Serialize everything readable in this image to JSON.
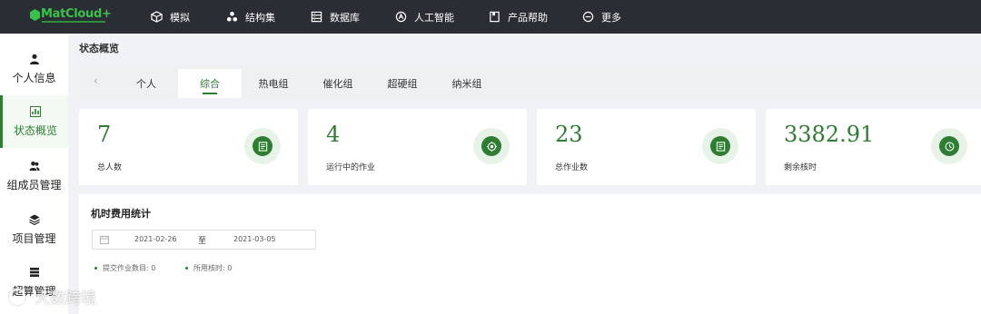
{
  "header": {
    "logo_text": "MatCloud+",
    "nav": [
      {
        "label": "模拟",
        "icon": "cube-icon"
      },
      {
        "label": "结构集",
        "icon": "molecule-icon"
      },
      {
        "label": "数据库",
        "icon": "database-icon"
      },
      {
        "label": "人工智能",
        "icon": "ai-icon"
      },
      {
        "label": "产品帮助",
        "icon": "help-book-icon"
      },
      {
        "label": "更多",
        "icon": "more-circle-icon"
      }
    ]
  },
  "sidebar": {
    "items": [
      {
        "label": "个人信息",
        "icon": "user-icon"
      },
      {
        "label": "状态概览",
        "icon": "chart-icon",
        "active": true
      },
      {
        "label": "组成员管理",
        "icon": "group-icon"
      },
      {
        "label": "项目管理",
        "icon": "layers-icon"
      },
      {
        "label": "超算管理",
        "icon": "server-icon"
      }
    ]
  },
  "main": {
    "page_title": "状态概览",
    "tabs": [
      {
        "label": "个人"
      },
      {
        "label": "综合",
        "active": true
      },
      {
        "label": "热电组"
      },
      {
        "label": "催化组"
      },
      {
        "label": "超硬组"
      },
      {
        "label": "纳米组"
      }
    ],
    "cards": [
      {
        "value": "7",
        "label": "总人数",
        "icon": "document-icon"
      },
      {
        "value": "4",
        "label": "运行中的作业",
        "icon": "target-icon"
      },
      {
        "value": "23",
        "label": "总作业数",
        "icon": "document-icon"
      },
      {
        "value": "3382.91",
        "label": "剩余核时",
        "icon": "clock-icon"
      }
    ],
    "stats": {
      "title": "机时费用统计",
      "date_start": "2021-02-26",
      "date_separator": "至",
      "date_end": "2021-03-05",
      "legend": [
        {
          "label": "提交作业数目: 0"
        },
        {
          "label": "所用核时: 0"
        }
      ]
    }
  },
  "watermark": {
    "text": "大数跨境"
  },
  "colors": {
    "accent": "#2e7d32",
    "topbar": "#2a2d33",
    "logo": "#39c24a"
  }
}
